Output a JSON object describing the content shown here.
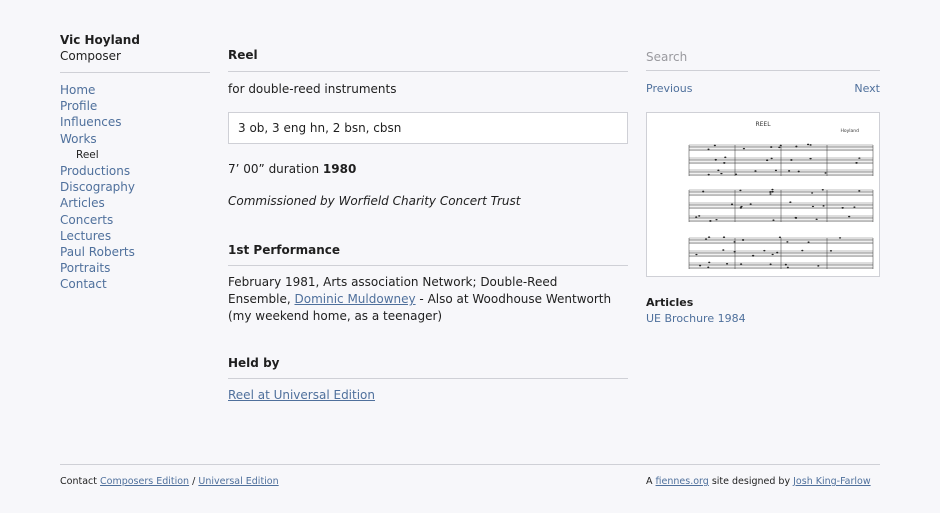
{
  "site": {
    "name": "Vic Hoyland",
    "subtitle": "Composer"
  },
  "nav": [
    {
      "label": "Home",
      "sub": false
    },
    {
      "label": "Profile",
      "sub": false
    },
    {
      "label": "Influences",
      "sub": false
    },
    {
      "label": "Works",
      "sub": false
    },
    {
      "label": "Reel",
      "sub": true
    },
    {
      "label": "Productions",
      "sub": false
    },
    {
      "label": "Discography",
      "sub": false
    },
    {
      "label": "Articles",
      "sub": false
    },
    {
      "label": "Concerts",
      "sub": false
    },
    {
      "label": "Lectures",
      "sub": false
    },
    {
      "label": "Paul Roberts",
      "sub": false
    },
    {
      "label": "Portraits",
      "sub": false
    },
    {
      "label": "Contact",
      "sub": false
    }
  ],
  "work": {
    "title": "Reel",
    "subtitle": "for double-reed instruments",
    "instrumentation": "3 ob, 3 eng hn, 2 bsn, cbsn",
    "duration": "7’ 00” duration",
    "year": "1980",
    "commission": "Commissioned by Worfield Charity Concert Trust"
  },
  "performance": {
    "heading": "1st Performance",
    "text_before": "February 1981, Arts association Network; Double-Reed Ensemble, ",
    "link": "Dominic Muldowney",
    "text_after": " - Also at Woodhouse Wentworth (my weekend home, as a teenager)"
  },
  "held": {
    "heading": "Held by",
    "link": "Reel at Universal Edition"
  },
  "sidebar": {
    "search_placeholder": "Search",
    "previous": "Previous",
    "next": "Next",
    "score": {
      "title": "REEL",
      "composer": "Hoyland"
    },
    "articles_heading": "Articles",
    "articles_link": "UE Brochure 1984"
  },
  "footer": {
    "contact": "Contact",
    "composers_edition": "Composers Edition",
    "sep": "/",
    "universal_edition": "Universal Edition",
    "a": "A",
    "fiennes": "fiennes.org",
    "designed_by": "site designed by",
    "designer": "Josh King-Farlow"
  }
}
